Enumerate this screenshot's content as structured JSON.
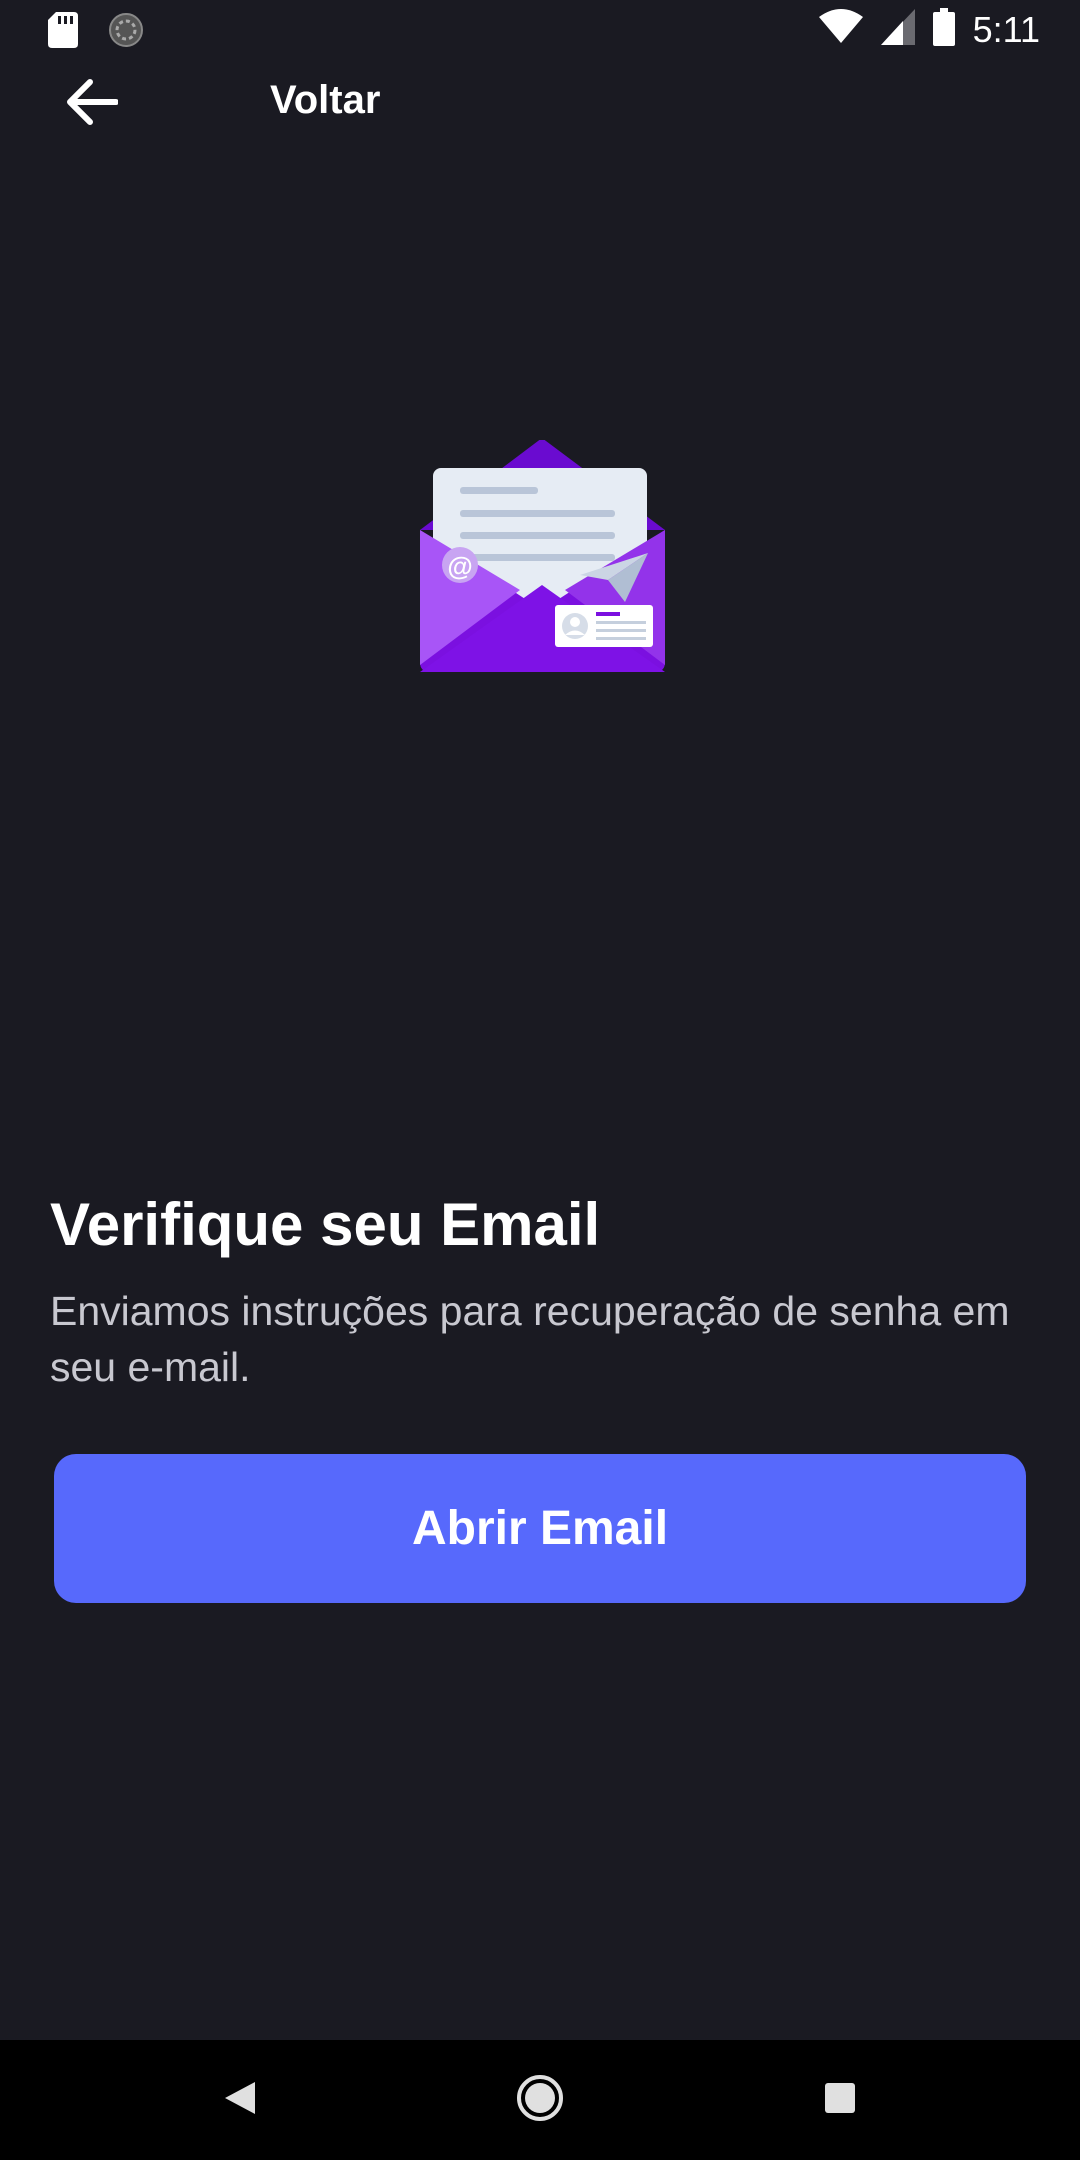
{
  "status_bar": {
    "time": "5:11",
    "icons": [
      "sd-card-icon",
      "sync-icon",
      "wifi-icon",
      "cell-signal-icon",
      "battery-icon"
    ]
  },
  "top_bar": {
    "back_icon": "arrow-left-icon",
    "title": "Voltar"
  },
  "illustration": {
    "icon": "envelope-icon",
    "at_symbol": "@",
    "colors": {
      "purple_dark": "#7b10e0",
      "purple_light": "#a855f7",
      "paper": "#e6ecf4"
    }
  },
  "content": {
    "heading": "Verifique seu Email",
    "description": "Enviamos instruções para recuperação de senha em seu e-mail."
  },
  "primary_button": {
    "label": "Abrir Email"
  },
  "nav_bar": {
    "icons": [
      "nav-back-icon",
      "nav-home-icon",
      "nav-recents-icon"
    ]
  },
  "colors": {
    "background": "#1a1a22",
    "accent": "#5769fc",
    "text_primary": "#ffffff",
    "text_secondary": "#c8c8d0"
  }
}
